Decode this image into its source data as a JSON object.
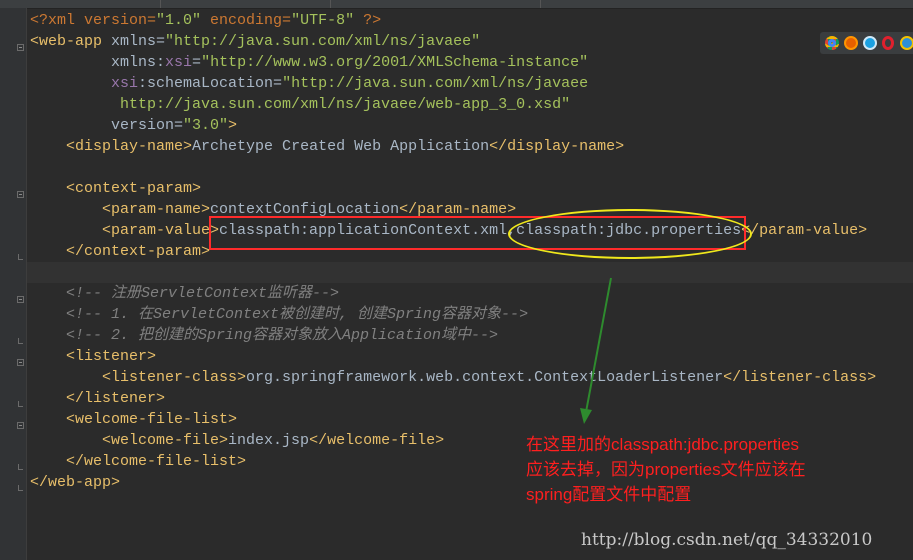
{
  "editor": {
    "lines": [
      [
        {
          "t": "p",
          "v": "<?xml version="
        },
        {
          "t": "s",
          "v": "\"1.0\""
        },
        {
          "t": "p",
          "v": " encoding="
        },
        {
          "t": "s",
          "v": "\"UTF-8\""
        },
        {
          "t": "p",
          "v": " ?>"
        }
      ],
      [
        {
          "t": "t",
          "v": "<web-app "
        },
        {
          "v": "xmlns="
        },
        {
          "t": "s",
          "v": "\"http://java.sun.com/xml/ns/javaee\""
        }
      ],
      [
        {
          "v": "         xmlns:"
        },
        {
          "t": "ns",
          "v": "xsi"
        },
        {
          "v": "="
        },
        {
          "t": "s",
          "v": "\"http://www.w3.org/2001/XMLSchema-instance\""
        }
      ],
      [
        {
          "v": "         "
        },
        {
          "t": "ns",
          "v": "xsi"
        },
        {
          "v": ":schemaLocation="
        },
        {
          "t": "s",
          "v": "\"http://java.sun.com/xml/ns/javaee"
        }
      ],
      [
        {
          "t": "s",
          "v": "          http://java.sun.com/xml/ns/javaee/web-app_3_0.xsd\""
        }
      ],
      [
        {
          "v": "         version="
        },
        {
          "t": "s",
          "v": "\"3.0\""
        },
        {
          "t": "t",
          "v": ">"
        }
      ],
      [
        {
          "v": "    "
        },
        {
          "t": "t",
          "v": "<display-name>"
        },
        {
          "v": "Archetype Created Web Application"
        },
        {
          "t": "t",
          "v": "</display-name>"
        }
      ],
      [
        {
          "v": ""
        }
      ],
      [
        {
          "v": "    "
        },
        {
          "t": "t",
          "v": "<context-param>"
        }
      ],
      [
        {
          "v": "        "
        },
        {
          "t": "t",
          "v": "<param-name>"
        },
        {
          "v": "contextConfigLocation"
        },
        {
          "t": "t",
          "v": "</param-name>"
        }
      ],
      [
        {
          "v": "        "
        },
        {
          "t": "t",
          "v": "<param-value>"
        },
        {
          "v": "classpath:applicationContext.xml,classpath:jdbc.properties"
        },
        {
          "t": "t",
          "v": "</param-value>"
        }
      ],
      [
        {
          "v": "    "
        },
        {
          "t": "t",
          "v": "</context-param>"
        }
      ],
      [
        {
          "v": ""
        }
      ],
      [
        {
          "v": "    "
        },
        {
          "t": "c",
          "v": "<!-- 注册ServletContext监听器-->"
        }
      ],
      [
        {
          "v": "    "
        },
        {
          "t": "c",
          "v": "<!-- 1. 在ServletContext被创建时, 创建Spring容器对象-->"
        }
      ],
      [
        {
          "v": "    "
        },
        {
          "t": "c",
          "v": "<!-- 2. 把创建的Spring容器对象放入Application域中-->"
        }
      ],
      [
        {
          "v": "    "
        },
        {
          "t": "t",
          "v": "<listener>"
        }
      ],
      [
        {
          "v": "        "
        },
        {
          "t": "t",
          "v": "<listener-class>"
        },
        {
          "v": "org.springframework.web.context.ContextLoaderListener"
        },
        {
          "t": "t",
          "v": "</listener-class>"
        }
      ],
      [
        {
          "v": "    "
        },
        {
          "t": "t",
          "v": "</listener>"
        }
      ],
      [
        {
          "v": "    "
        },
        {
          "t": "t",
          "v": "<welcome-file-list>"
        }
      ],
      [
        {
          "v": "        "
        },
        {
          "t": "t",
          "v": "<welcome-file>"
        },
        {
          "v": "index.jsp"
        },
        {
          "t": "t",
          "v": "</welcome-file>"
        }
      ],
      [
        {
          "v": "    "
        },
        {
          "t": "t",
          "v": "</welcome-file-list>"
        }
      ],
      [
        {
          "t": "t",
          "v": "</web-app>"
        }
      ]
    ]
  },
  "annotation": {
    "line1": "在这里加的classpath:jdbc.properties",
    "line2": "应该去掉，因为properties文件应该在",
    "line3": "spring配置文件中配置",
    "highlight_color": "#ff2b2b",
    "ellipse_color": "#f0e81c",
    "arrow_color": "#2e8b2e"
  },
  "watermark": "http://blog.csdn.net/qq_34332010",
  "browser_icons": [
    "chrome-icon",
    "firefox-icon",
    "ie-icon",
    "opera-icon",
    "safari-icon"
  ]
}
